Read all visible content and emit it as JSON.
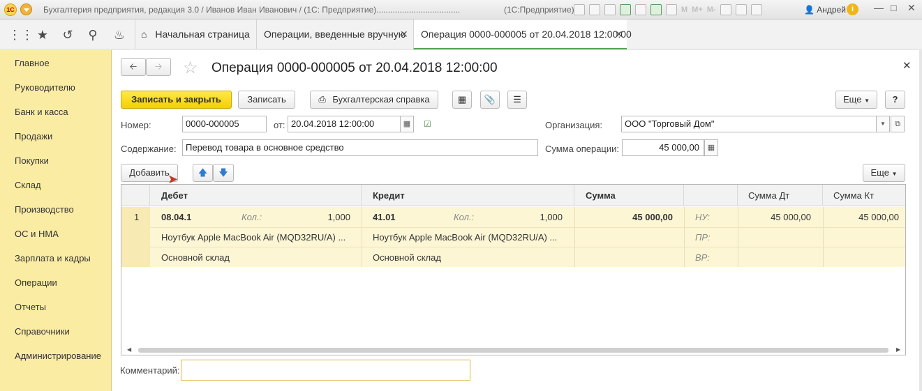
{
  "window": {
    "logo_text": "1С",
    "title": "Бухгалтерия предприятия, редакция 3.0 / Иванов Иван Иванович / (1С: Предприятие)....................................",
    "app_name": "(1С:Предприятие)",
    "toolbar_letters": [
      "M",
      "M+",
      "M-"
    ],
    "user": "Андрей"
  },
  "tabs": [
    {
      "label": "Начальная страница"
    },
    {
      "label": "Операции, введенные вручную"
    },
    {
      "label": "Операция 0000-000005 от 20.04.2018 12:00:00"
    }
  ],
  "sidebar": {
    "items": [
      {
        "label": "Главное"
      },
      {
        "label": "Руководителю"
      },
      {
        "label": "Банк и касса"
      },
      {
        "label": "Продажи"
      },
      {
        "label": "Покупки"
      },
      {
        "label": "Склад"
      },
      {
        "label": "Производство"
      },
      {
        "label": "ОС и НМА"
      },
      {
        "label": "Зарплата и кадры"
      },
      {
        "label": "Операции"
      },
      {
        "label": "Отчеты"
      },
      {
        "label": "Справочники"
      },
      {
        "label": "Администрирование"
      }
    ]
  },
  "form": {
    "title": "Операция 0000-000005 от 20.04.2018 12:00:00",
    "buttons": {
      "save_close": "Записать и закрыть",
      "save": "Записать",
      "report": "Бухгалтерская справка",
      "more": "Еще",
      "help": "?",
      "add": "Добавить",
      "table_more": "Еще"
    },
    "number_label": "Номер:",
    "number_value": "0000-000005",
    "date_label": "от:",
    "date_value": "20.04.2018 12:00:00",
    "org_label": "Организация:",
    "org_value": "ООО \"Торговый Дом\"",
    "content_label": "Содержание:",
    "content_value": "Перевод товара в основное средство",
    "sum_label": "Сумма операции:",
    "sum_value": "45 000,00",
    "comment_label": "Комментарий:",
    "comment_value": ""
  },
  "table": {
    "headers": [
      "Дебет",
      "Кредит",
      "Сумма",
      "Сумма Дт",
      "Сумма Кт"
    ],
    "row": {
      "num": "1",
      "debit_account": "08.04.1",
      "debit_qty_label": "Кол.:",
      "debit_qty": "1,000",
      "debit_item": "Ноутбук Apple MacBook Air (MQD32RU/A) ...",
      "debit_warehouse": "Основной склад",
      "credit_account": "41.01",
      "credit_qty_label": "Кол.:",
      "credit_qty": "1,000",
      "credit_item": "Ноутбук Apple MacBook Air (MQD32RU/A) ...",
      "credit_warehouse": "Основной склад",
      "amount": "45 000,00",
      "nu_label": "НУ:",
      "pr_label": "ПР:",
      "vr_label": "ВР:",
      "sum_dt": "45 000,00",
      "sum_kt": "45 000,00"
    }
  }
}
